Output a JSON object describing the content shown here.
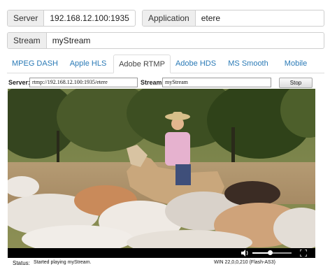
{
  "server": {
    "label": "Server",
    "value": "192.168.12.100:1935"
  },
  "application": {
    "label": "Application",
    "value": "etere"
  },
  "stream": {
    "label": "Stream",
    "value": "myStream"
  },
  "tabs": [
    {
      "label": "MPEG DASH"
    },
    {
      "label": "Apple HLS"
    },
    {
      "label": "Adobe RTMP",
      "active": true
    },
    {
      "label": "Adobe HDS"
    },
    {
      "label": "MS Smooth"
    },
    {
      "label": "Mobile"
    }
  ],
  "player": {
    "server_label": "Server:",
    "server_value": "rtmp://192.168.12.100:1935/etere",
    "stream_label": "Stream:",
    "stream_value": "myStream",
    "stop_label": "Stop",
    "status_label": "Status:",
    "status_text": "Started playing myStream.",
    "version_text": "WIN 22,0,0,210 (Flash-AS3)",
    "volume_level": 0.45
  },
  "icons": {
    "volume": "speaker-icon",
    "fullscreen": "fullscreen-icon"
  },
  "colors": {
    "tab_link": "#2a7ab6",
    "addon_bg": "#eeeeee",
    "control_bar": "#000000"
  }
}
